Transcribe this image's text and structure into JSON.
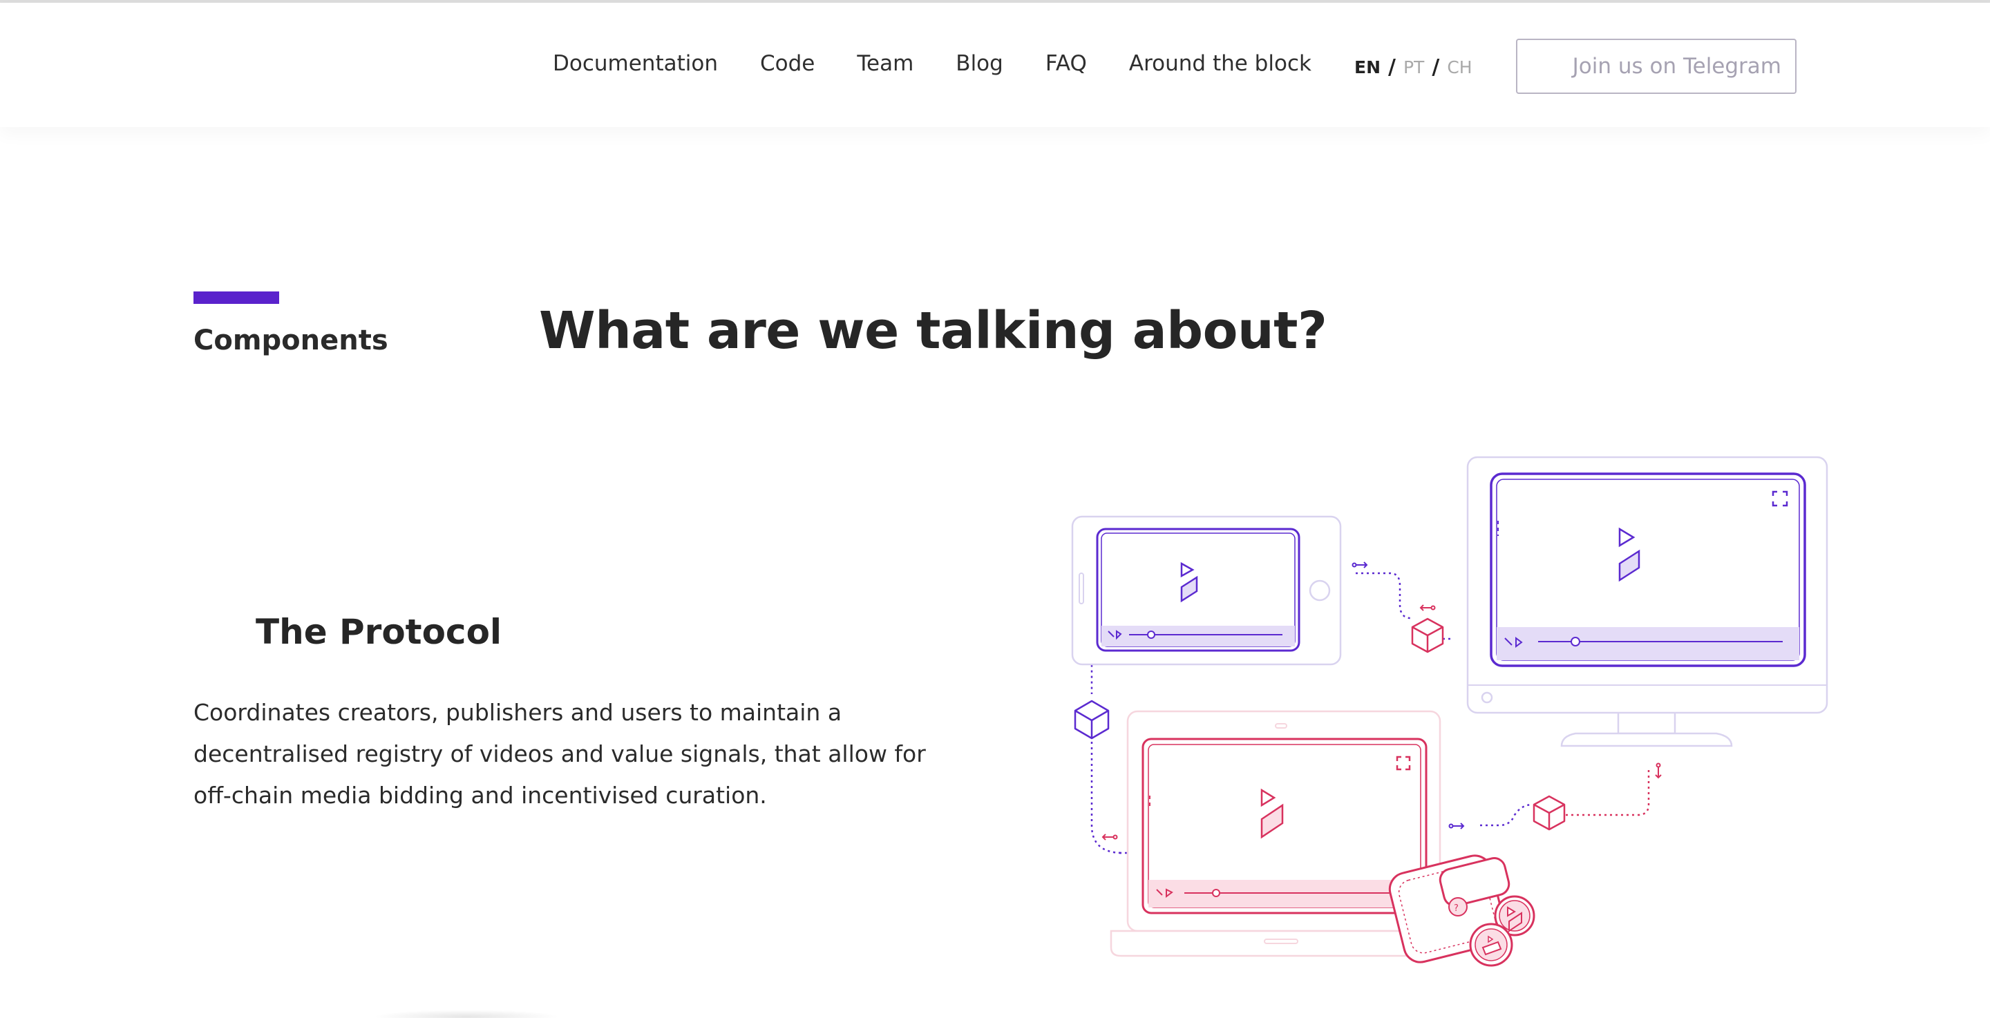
{
  "nav": {
    "links": [
      "Documentation",
      "Code",
      "Team",
      "Blog",
      "FAQ",
      "Around the block"
    ],
    "languages": {
      "active": "EN",
      "others": [
        "PT",
        "CH"
      ],
      "separator": "/"
    },
    "telegram_button": "Join us on Telegram"
  },
  "section": {
    "label": "Components",
    "title": "What are we talking about?",
    "subtitle": "The Protocol",
    "description": "Coordinates creators, publishers and users to maintain a decentralised registry of videos and value signals, that allow for off-chain media bidding and incentivised curation."
  },
  "colors": {
    "accent": "#5a22cc",
    "purple_line": "#5b2ad0",
    "purple_fill": "#e4dcf7",
    "pink_line": "#d8325e",
    "pink_fill": "#fbdde5",
    "device_outline_purple": "#d9d3ef",
    "device_outline_pink": "#f6d6de"
  },
  "icons": [
    "play-icon",
    "fullscreen-icon",
    "cube-icon",
    "volume-icon",
    "arrow-icon"
  ]
}
